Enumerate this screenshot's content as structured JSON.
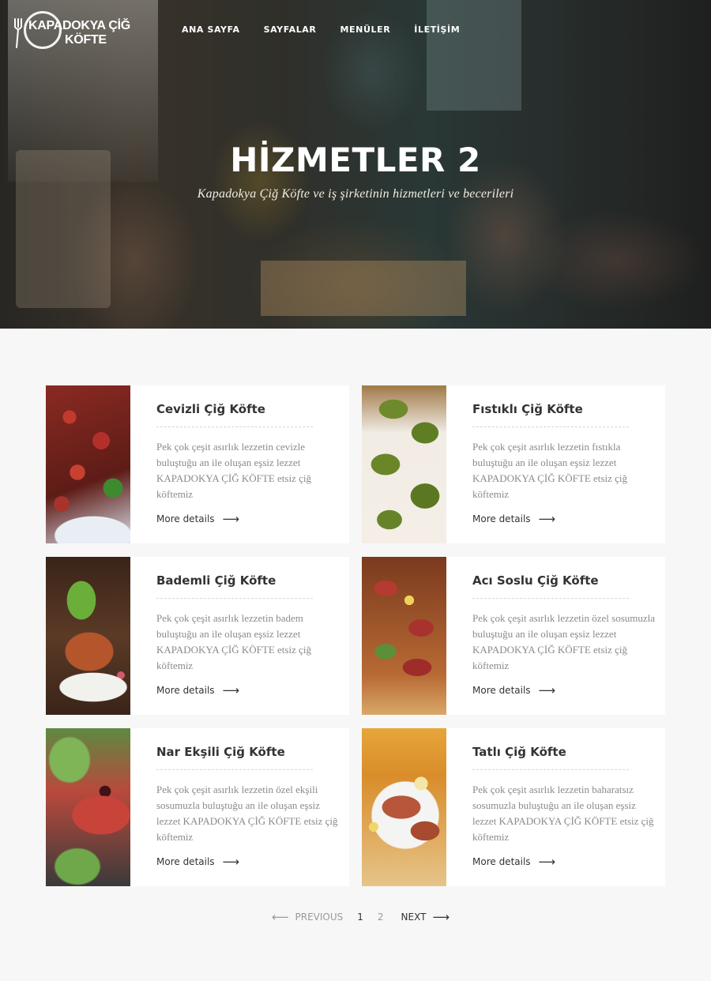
{
  "brand": {
    "line1": "KAPADOKYA ÇİĞ",
    "line2": "KÖFTE"
  },
  "nav": {
    "items": [
      {
        "label": "ANA SAYFA"
      },
      {
        "label": "SAYFALAR"
      },
      {
        "label": "MENÜLER"
      },
      {
        "label": "İLETİŞİM"
      }
    ]
  },
  "hero": {
    "title": "HİZMETLER 2",
    "subtitle": "Kapadokya Çiğ Köfte ve iş şirketinin hizmetleri ve becerileri"
  },
  "services": [
    {
      "title": "Cevizli Çiğ Köfte",
      "text": "Pek çok çeşit asırlık lezzetin cevizle buluştuğu an ile oluşan eşsiz lezzet KAPADOKYA ÇİĞ KÖFTE etsiz çiğ köftemiz",
      "link": "More details"
    },
    {
      "title": "Fıstıklı Çiğ Köfte",
      "text": "Pek çok çeşit asırlık lezzetin fıstıkla buluştuğu an ile oluşan eşsiz lezzet KAPADOKYA ÇİĞ KÖFTE etsiz çiğ köftemiz",
      "link": "More details"
    },
    {
      "title": "Bademli Çiğ Köfte",
      "text": "Pek çok çeşit asırlık lezzetin badem buluştuğu an ile oluşan eşsiz lezzet KAPADOKYA ÇİĞ KÖFTE etsiz çiğ köftemiz",
      "link": "More details"
    },
    {
      "title": "Acı Soslu Çiğ Köfte",
      "text": "Pek çok çeşit asırlık lezzetin özel sosumuzla buluştuğu an ile oluşan eşsiz lezzet KAPADOKYA ÇİĞ KÖFTE etsiz çiğ köftemiz",
      "link": "More details"
    },
    {
      "title": "Nar Ekşili Çiğ Köfte",
      "text": "Pek çok çeşit asırlık lezzetin özel ekşili sosumuzla buluştuğu an ile oluşan eşsiz lezzet KAPADOKYA ÇİĞ KÖFTE etsiz çiğ köftemiz",
      "link": "More details"
    },
    {
      "title": "Tatlı Çiğ Köfte",
      "text": "Pek çok çeşit asırlık lezzetin baharatsız sosumuzla buluştuğu an ile oluşan eşsiz lezzet KAPADOKYA ÇİĞ KÖFTE etsiz çiğ köftemiz",
      "link": "More details"
    }
  ],
  "pagination": {
    "prev": "PREVIOUS",
    "pages": [
      "1",
      "2"
    ],
    "current": "1",
    "next": "NEXT"
  },
  "colors": {
    "background": "#f7f7f7",
    "card": "#ffffff",
    "text": "#333333",
    "muted": "#8a8a8a"
  }
}
